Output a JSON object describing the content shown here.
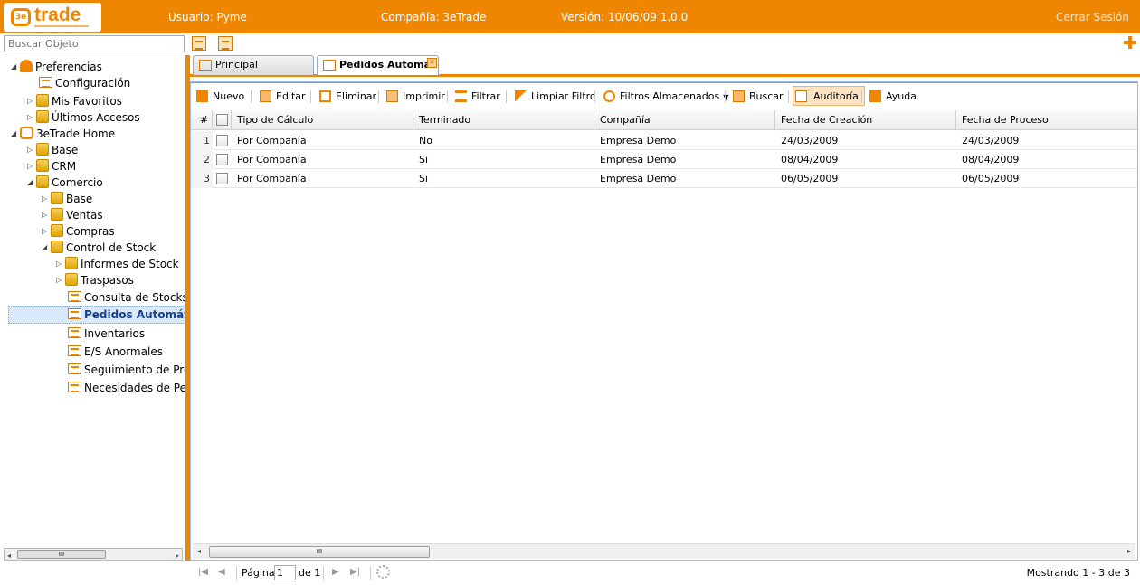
{
  "header": {
    "logo_text": "trade",
    "user": "Usuario: Pyme",
    "company": "Compañía: 3eTrade",
    "version": "Versión: 10/06/09 1.0.0",
    "logout": "Cerrar Sesión"
  },
  "search": {
    "placeholder": "Buscar Objeto"
  },
  "tree": {
    "preferencias": "Preferencias",
    "configuracion": "Configuración",
    "favoritos": "Mis Favoritos",
    "ultimos": "Últimos Accesos",
    "home": "3eTrade Home",
    "base": "Base",
    "crm": "CRM",
    "comercio": "Comercio",
    "comercio_base": "Base",
    "ventas": "Ventas",
    "compras": "Compras",
    "control_stock": "Control de Stock",
    "informes": "Informes de Stock",
    "traspasos": "Traspasos",
    "consulta": "Consulta de Stocks",
    "pedidos": "Pedidos Automáti",
    "inventarios": "Inventarios",
    "es_anormales": "E/S Anormales",
    "seguimiento": "Seguimiento de Pro",
    "necesidades": "Necesidades de Pec"
  },
  "tabs": {
    "principal": "Principal",
    "pedidos": "Pedidos Automát"
  },
  "toolbar": {
    "nuevo": "Nuevo",
    "editar": "Editar",
    "eliminar": "Eliminar",
    "imprimir": "Imprimir",
    "filtrar": "Filtrar",
    "limpiar": "Limpiar Filtro",
    "filtros": "Filtros Almacenados",
    "buscar": "Buscar",
    "auditoria": "Auditoría",
    "ayuda": "Ayuda"
  },
  "grid": {
    "columns": [
      "#",
      "Tipo de Cálculo",
      "Terminado",
      "Compañía",
      "Fecha de Creación",
      "Fecha de Proceso"
    ],
    "rows": [
      {
        "n": "1",
        "tipo": "Por Compañía",
        "terminado": "No",
        "compania": "Empresa Demo",
        "creacion": "24/03/2009",
        "proceso": "24/03/2009"
      },
      {
        "n": "2",
        "tipo": "Por Compañía",
        "terminado": "Si",
        "compania": "Empresa Demo",
        "creacion": "08/04/2009",
        "proceso": "08/04/2009"
      },
      {
        "n": "3",
        "tipo": "Por Compañía",
        "terminado": "Si",
        "compania": "Empresa Demo",
        "creacion": "06/05/2009",
        "proceso": "06/05/2009"
      }
    ]
  },
  "pager": {
    "page_label": "Página",
    "page": "1",
    "of": "de 1",
    "showing": "Mostrando 1 - 3 de 3"
  },
  "colors": {
    "accent": "#ef8600",
    "selection": "#d9e8fb"
  }
}
